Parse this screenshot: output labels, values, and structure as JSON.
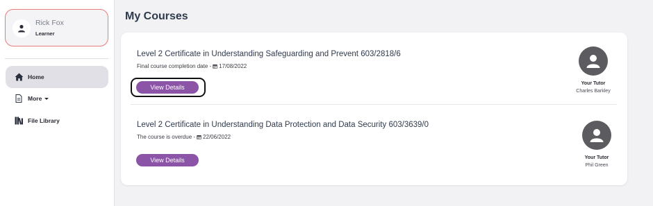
{
  "user": {
    "name": "Rick Fox",
    "role": "Learner"
  },
  "nav": [
    {
      "label": "Home",
      "icon": "home-icon",
      "active": true
    },
    {
      "label": "More",
      "icon": "document-icon",
      "dropdown": true
    },
    {
      "label": "File Library",
      "icon": "library-icon"
    }
  ],
  "page": {
    "title": "My Courses"
  },
  "courses": [
    {
      "title": "Level 2 Certificate in Understanding Safeguarding and Prevent 603/2818/6",
      "status_label": "Final course completion date -",
      "date": "17/08/2022",
      "button_label": "View Details",
      "tutor_heading": "Your Tutor",
      "tutor_name": "Charles Barkley"
    },
    {
      "title": "Level 2 Certificate in Understanding Data Protection and Data Security 603/3639/0",
      "status_label": "The course is overdue -",
      "date": "22/06/2022",
      "button_label": "View Details",
      "tutor_heading": "Your Tutor",
      "tutor_name": "Phil Green"
    }
  ],
  "colors": {
    "accent": "#8b54a6",
    "user_card_border": "#e87a7a",
    "avatar": "#5c5c60"
  }
}
